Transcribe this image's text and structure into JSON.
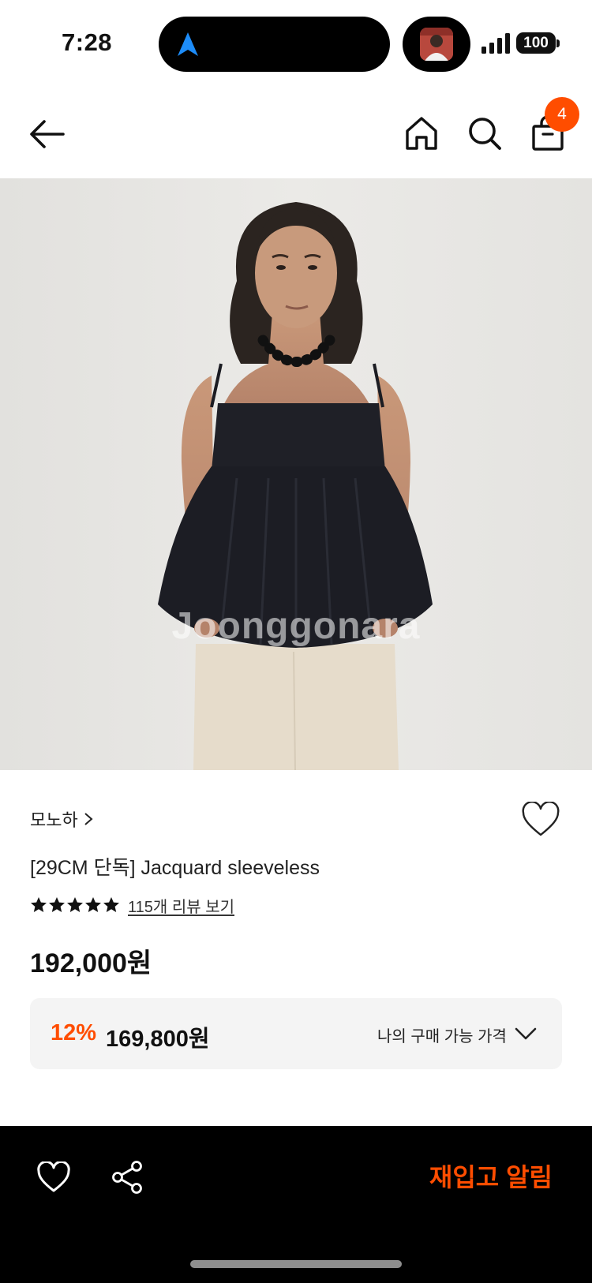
{
  "status_bar": {
    "time": "7:28",
    "battery": "100",
    "icons": [
      "navigation-arrow-icon",
      "live-activity-thumbnail",
      "cellular-signal-icon",
      "battery-icon"
    ]
  },
  "nav": {
    "icons": [
      "back-arrow-icon",
      "home-icon",
      "search-icon",
      "shopping-bag-icon"
    ],
    "cart_count": "4"
  },
  "product": {
    "image_watermark": "Joonggonara",
    "brand": "모노하",
    "title": "[29CM 단독] Jacquard sleeveless",
    "rating_stars": 5,
    "review_link": "115개 리뷰 보기",
    "price": "192,000원",
    "my_price": {
      "discount_rate": "12%",
      "discount_price": "169,800원",
      "label": "나의 구매 가능 가격"
    }
  },
  "bottom_bar": {
    "icons": [
      "heart-outline-icon",
      "share-icon"
    ],
    "restock_button": "재입고 알림"
  },
  "colors": {
    "accent": "#ff4d00",
    "bottom_bar": "#000000",
    "price_box_bg": "#f4f4f4"
  }
}
